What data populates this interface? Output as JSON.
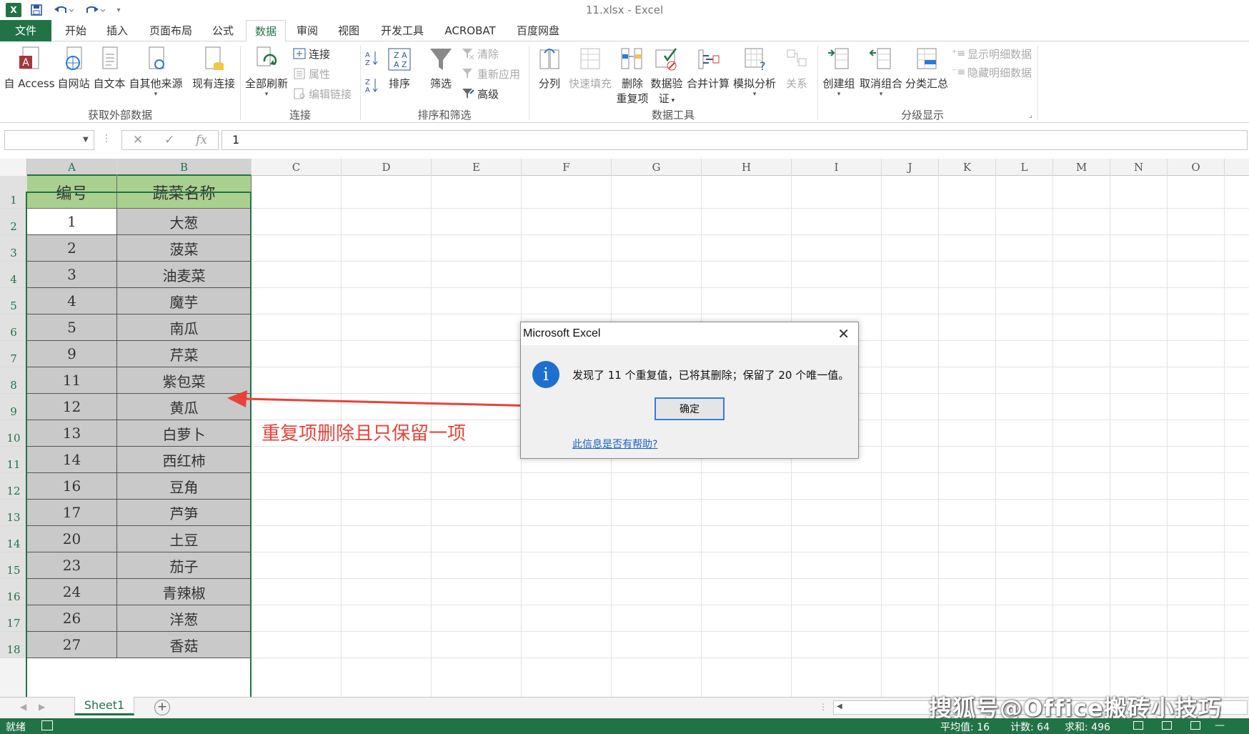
{
  "window": {
    "title": "11.xlsx - Excel",
    "logo": "X"
  },
  "quick_access": {
    "save_icon": "save-icon",
    "undo_icon": "undo-icon",
    "redo_icon": "redo-icon"
  },
  "tabs": [
    {
      "label": "文件"
    },
    {
      "label": "开始"
    },
    {
      "label": "插入"
    },
    {
      "label": "页面布局"
    },
    {
      "label": "公式"
    },
    {
      "label": "数据"
    },
    {
      "label": "审阅"
    },
    {
      "label": "视图"
    },
    {
      "label": "开发工具"
    },
    {
      "label": "ACROBAT"
    },
    {
      "label": "百度网盘"
    }
  ],
  "ribbon": {
    "get_external": {
      "access": "自 Access",
      "web": "自网站",
      "text": "自文本",
      "other": "自其他来源",
      "existing": "现有连接",
      "group": "获取外部数据"
    },
    "connections": {
      "refresh_all": "全部刷新",
      "connections": "连接",
      "properties": "属性",
      "edit_links": "编辑链接",
      "group": "连接"
    },
    "sort_filter": {
      "sort": "排序",
      "filter": "筛选",
      "clear": "清除",
      "reapply": "重新应用",
      "advanced": "高级",
      "group": "排序和筛选"
    },
    "data_tools": {
      "text_to_columns": "分列",
      "flash_fill": "快速填充",
      "remove_dup_1": "删除",
      "remove_dup_2": "重复项",
      "validation_1": "数据验",
      "validation_2": "证",
      "consolidate": "合并计算",
      "what_if": "模拟分析",
      "relationships": "关系",
      "group": "数据工具"
    },
    "outline": {
      "group_btn": "创建组",
      "ungroup": "取消组合",
      "subtotal": "分类汇总",
      "show_detail": "显示明细数据",
      "hide_detail": "隐藏明细数据",
      "group": "分级显示"
    }
  },
  "formula_bar": {
    "name_box": "",
    "value": "1",
    "fx": "fx"
  },
  "columns": [
    "A",
    "B",
    "C",
    "D",
    "E",
    "F",
    "G",
    "H",
    "I",
    "J",
    "K",
    "L",
    "M",
    "N",
    "O"
  ],
  "rows": [
    "1",
    "2",
    "3",
    "4",
    "5",
    "6",
    "7",
    "8",
    "9",
    "10",
    "11",
    "12",
    "13",
    "14",
    "15",
    "16",
    "17",
    "18"
  ],
  "table": {
    "headers": [
      "编号",
      "蔬菜名称"
    ],
    "data": [
      [
        "1",
        "大葱"
      ],
      [
        "2",
        "菠菜"
      ],
      [
        "3",
        "油麦菜"
      ],
      [
        "4",
        "魔芋"
      ],
      [
        "5",
        "南瓜"
      ],
      [
        "9",
        "芹菜"
      ],
      [
        "11",
        "紫包菜"
      ],
      [
        "12",
        "黄瓜"
      ],
      [
        "13",
        "白萝卜"
      ],
      [
        "14",
        "西红柿"
      ],
      [
        "16",
        "豆角"
      ],
      [
        "17",
        "芦笋"
      ],
      [
        "20",
        "土豆"
      ],
      [
        "23",
        "茄子"
      ],
      [
        "24",
        "青辣椒"
      ],
      [
        "26",
        "洋葱"
      ],
      [
        "27",
        "香菇"
      ]
    ]
  },
  "annotation": {
    "text": "重复项删除且只保留一项",
    "color": "#e8423a"
  },
  "dialog": {
    "title": "Microsoft Excel",
    "close": "✕",
    "icon": "i",
    "message": "发现了 11 个重复值，已将其删除；保留了 20 个唯一值。",
    "ok": "确定",
    "help": "此信息是否有帮助?"
  },
  "sheet_tabs": [
    {
      "label": "Sheet1"
    }
  ],
  "add_sheet": "+",
  "status": {
    "ready": "就绪",
    "average": "平均值: 16",
    "count": "计数: 64",
    "sum": "求和: 496"
  },
  "watermark": "搜狐号@Office搬砖小技巧",
  "colors": {
    "excel_green": "#217346",
    "header_fill": "#a9d08e",
    "data_fill": "#c9c9c9"
  }
}
